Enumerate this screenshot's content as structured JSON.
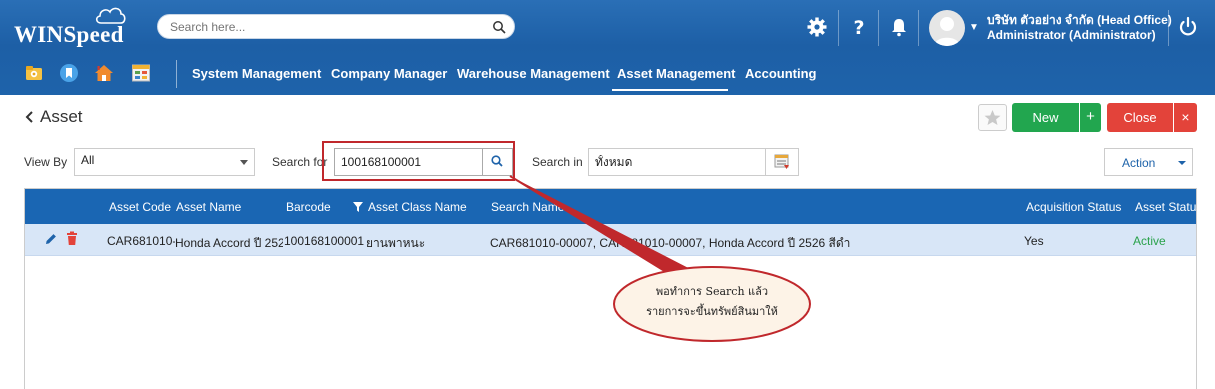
{
  "header": {
    "logo": "WINSpeed",
    "search_placeholder": "Search here...",
    "user_company": "บริษัท ตัวอย่าง จำกัด (Head Office)",
    "user_role": "Administrator (Administrator)",
    "icons": [
      "gear-icon",
      "help-icon",
      "bell-icon",
      "avatar",
      "power-icon"
    ]
  },
  "nav": {
    "items": [
      "System Management",
      "Company Manager",
      "Warehouse Management",
      "Asset Management",
      "Accounting"
    ],
    "active": "Asset Management"
  },
  "page": {
    "title": "Asset",
    "new_label": "New",
    "new_plus": "+",
    "close_label": "Close",
    "close_x": "×"
  },
  "filters": {
    "view_by_label": "View By",
    "view_by_value": "All",
    "search_for_label": "Search for",
    "search_for_value": "100168100001",
    "search_in_label": "Search in",
    "search_in_value": "ทั้งหมด",
    "action_label": "Action"
  },
  "grid": {
    "columns": [
      "Asset Code",
      "Asset Name",
      "Barcode",
      "Asset Class Name",
      "Search Name",
      "Acquisition Status",
      "Asset Status"
    ],
    "rows": [
      {
        "asset_code": "CAR681010-",
        "asset_name": "Honda Accord ปี 252",
        "barcode": "100168100001",
        "asset_class": "ยานพาหนะ",
        "search_name": "CAR681010-00007, CAR681010-00007, Honda Accord ปี 2526 สีดำ",
        "acquisition_status": "Yes",
        "asset_status": "Active"
      }
    ]
  },
  "callout": {
    "line1": "พอทำการ Search แล้ว",
    "line2": "รายการจะขึ้นทรัพย์สินมาให้"
  },
  "colors": {
    "header_blue": "#1e63aa",
    "green": "#22a64f",
    "red": "#e3433a",
    "row_selected": "#d8e6f7"
  }
}
